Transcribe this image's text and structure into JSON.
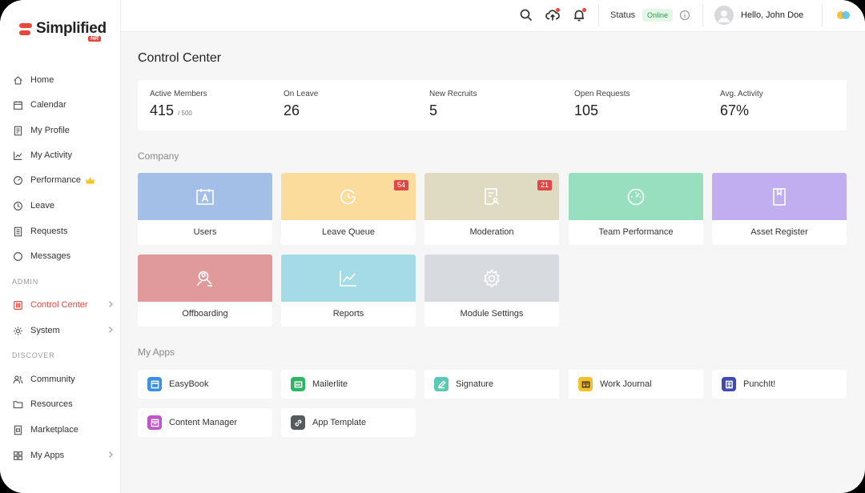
{
  "brand": {
    "name": "Simplified",
    "badge": "HR"
  },
  "sidebar": {
    "items": [
      {
        "label": "Home"
      },
      {
        "label": "Calendar"
      },
      {
        "label": "My Profile"
      },
      {
        "label": "My Activity"
      },
      {
        "label": "Performance"
      },
      {
        "label": "Leave"
      },
      {
        "label": "Requests"
      },
      {
        "label": "Messages"
      }
    ],
    "admin_label": "ADMIN",
    "admin_items": [
      {
        "label": "Control Center"
      },
      {
        "label": "System"
      }
    ],
    "discover_label": "DISCOVER",
    "discover_items": [
      {
        "label": "Community"
      },
      {
        "label": "Resources"
      },
      {
        "label": "Marketplace"
      },
      {
        "label": "My Apps"
      }
    ]
  },
  "header": {
    "status_label": "Status",
    "status_value": "Online",
    "greeting": "Hello, John Doe"
  },
  "main": {
    "title": "Control Center",
    "stats": [
      {
        "label": "Active Members",
        "value": "415",
        "suffix": "/ 500"
      },
      {
        "label": "On Leave",
        "value": "26"
      },
      {
        "label": "New Recruits",
        "value": "5"
      },
      {
        "label": "Open Requests",
        "value": "105"
      },
      {
        "label": "Avg. Activity",
        "value": "67%"
      }
    ],
    "company_title": "Company",
    "company_tiles": [
      {
        "label": "Users",
        "color": "#a3bfe8"
      },
      {
        "label": "Leave Queue",
        "color": "#fbdc9c",
        "badge": "54"
      },
      {
        "label": "Moderation",
        "color": "#dfdbc2",
        "badge": "21"
      },
      {
        "label": "Team Performance",
        "color": "#97dfbf"
      },
      {
        "label": "Asset Register",
        "color": "#c1aef1"
      },
      {
        "label": "Offboarding",
        "color": "#e19a9c"
      },
      {
        "label": "Reports",
        "color": "#a5dbe7"
      },
      {
        "label": "Module Settings",
        "color": "#d7dbe0"
      }
    ],
    "apps_title": "My Apps",
    "apps": [
      {
        "label": "EasyBook",
        "color": "#3d8fe0"
      },
      {
        "label": "Mailerlite",
        "color": "#2fb665"
      },
      {
        "label": "Signature",
        "color": "#57c9b4"
      },
      {
        "label": "Work Journal",
        "color": "#f0c02d"
      },
      {
        "label": "PunchIt!",
        "color": "#3f4bb3"
      },
      {
        "label": "Content Manager",
        "color": "#c054c9"
      },
      {
        "label": "App Template",
        "color": "#555b5e"
      }
    ]
  }
}
